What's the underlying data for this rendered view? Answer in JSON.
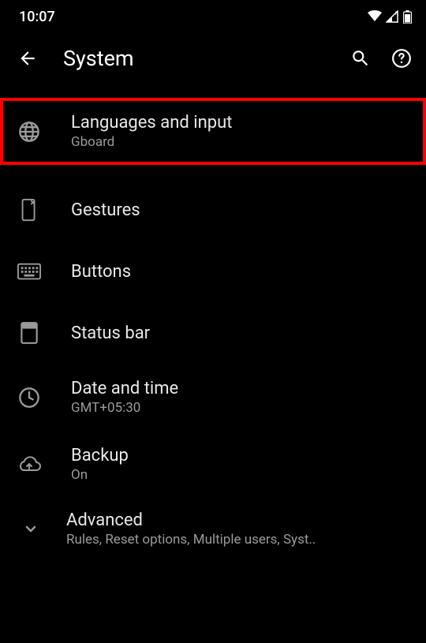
{
  "status": {
    "time": "10:07"
  },
  "header": {
    "title": "System"
  },
  "items": [
    {
      "label": "Languages and input",
      "sublabel": "Gboard"
    },
    {
      "label": "Gestures"
    },
    {
      "label": "Buttons"
    },
    {
      "label": "Status bar"
    },
    {
      "label": "Date and time",
      "sublabel": "GMT+05:30"
    },
    {
      "label": "Backup",
      "sublabel": "On"
    },
    {
      "label": "Advanced",
      "sublabel": "Rules, Reset options, Multiple users, Syst.."
    }
  ]
}
